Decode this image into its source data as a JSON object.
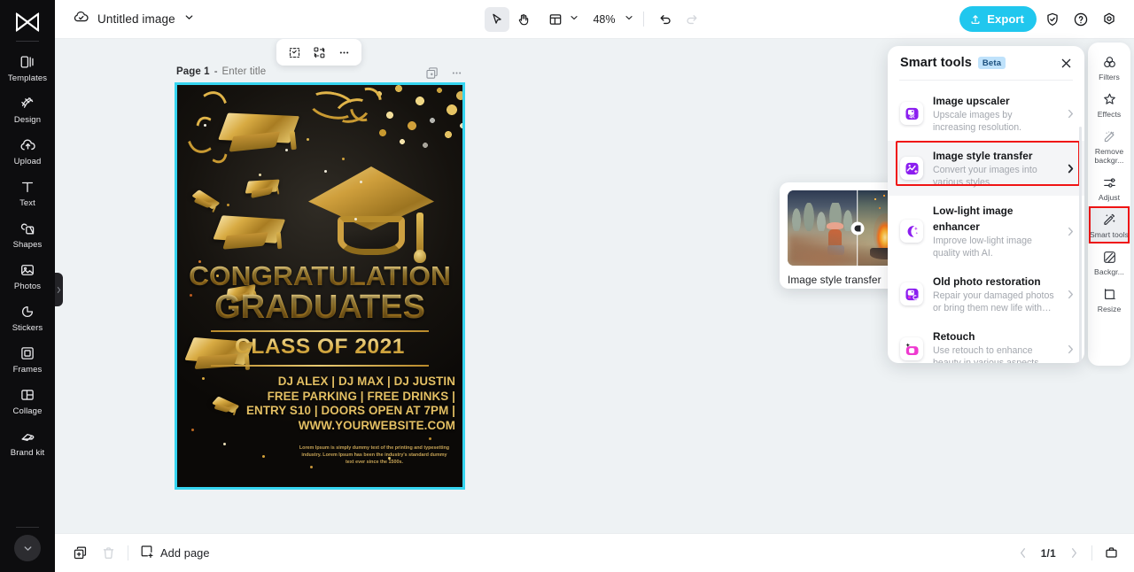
{
  "left_rail": {
    "logo_name": "capcut-logo",
    "items": [
      {
        "label": "Templates",
        "icon": "templates-icon"
      },
      {
        "label": "Design",
        "icon": "design-icon"
      },
      {
        "label": "Upload",
        "icon": "upload-icon"
      },
      {
        "label": "Text",
        "icon": "text-icon"
      },
      {
        "label": "Shapes",
        "icon": "shapes-icon"
      },
      {
        "label": "Photos",
        "icon": "photos-icon"
      },
      {
        "label": "Stickers",
        "icon": "stickers-icon"
      },
      {
        "label": "Frames",
        "icon": "frames-icon"
      },
      {
        "label": "Collage",
        "icon": "collage-icon"
      },
      {
        "label": "Brand kit",
        "icon": "brand-kit-icon"
      }
    ]
  },
  "topbar": {
    "cloud_icon": "cloud-check-icon",
    "doc_title": "Untitled image",
    "title_caret": "chevron-down-icon",
    "select_tool": "cursor-arrow-icon",
    "hand_tool": "hand-icon",
    "layout_tool": "layout-icon",
    "zoom_value": "48%",
    "undo": "undo-icon",
    "redo": "redo-icon",
    "export_label": "Export",
    "shield": "shield-icon",
    "help": "help-circle-icon",
    "settings": "settings-icon"
  },
  "canvas": {
    "page_label": "Page 1",
    "page_dash": "-",
    "page_title_placeholder": "Enter title",
    "float_tools": [
      "crop-icon",
      "replace-icon",
      "more-horizontal-icon"
    ],
    "page_actions": [
      "duplicate-page-icon",
      "more-horizontal-icon"
    ],
    "selection_color": "#36d5f0"
  },
  "poster": {
    "headline_1": "CONGRATULATION",
    "headline_2": "GRADUATES",
    "subtitle": "CLASS OF 2021",
    "detail_lines": [
      "DJ ALEX | DJ MAX | DJ JUSTIN",
      "FREE  PARKING | FREE DRINKS |",
      "ENTRY S10 | DOORS OPEN AT 7PM |",
      "WWW.YOURWEBSITE.COM"
    ],
    "lorem": "Lorem Ipsum is simply dummy text of the printing and typesetting industry. Lorem Ipsum has been the industry's standard dummy text ever since the 1500s.",
    "gold_color": "#d9ae45"
  },
  "preview_card": {
    "caption": "Image style transfer",
    "handle_icon": "compare-slider-handle-icon"
  },
  "smart_panel": {
    "title": "Smart tools",
    "badge": "Beta",
    "close_icon": "close-icon",
    "items": [
      {
        "name": "Image upscaler",
        "desc": "Upscale images by increasing resolution.",
        "icon": "image-upscaler-icon",
        "arrow": "chevron-right-icon"
      },
      {
        "name": "Image style transfer",
        "desc": "Convert your images into various styles.",
        "icon": "image-style-transfer-icon",
        "arrow": "chevron-right-icon"
      },
      {
        "name": "Low-light image enhancer",
        "desc": "Improve low-light image quality with AI.",
        "icon": "low-light-enhancer-icon",
        "arrow": "chevron-right-icon"
      },
      {
        "name": "Old photo restoration",
        "desc": "Repair your damaged photos or bring them new life with…",
        "icon": "old-photo-restoration-icon",
        "arrow": "chevron-right-icon"
      },
      {
        "name": "Retouch",
        "desc": "Use retouch to enhance beauty in various aspects.",
        "icon": "retouch-icon",
        "arrow": "chevron-right-icon"
      }
    ],
    "highlight_color": "#f01414"
  },
  "right_rail": {
    "items": [
      {
        "label": "Filters",
        "icon": "filters-icon"
      },
      {
        "label": "Effects",
        "icon": "effects-icon"
      },
      {
        "label": "Remove backgr...",
        "icon": "remove-background-icon"
      },
      {
        "label": "Adjust",
        "icon": "adjust-icon"
      },
      {
        "label": "Smart tools",
        "icon": "smart-tools-icon"
      },
      {
        "label": "Backgr...",
        "icon": "background-icon"
      },
      {
        "label": "Resize",
        "icon": "resize-icon"
      }
    ],
    "active_index": 4
  },
  "bottombar": {
    "duplicate_icon": "duplicate-icon",
    "delete_icon": "trash-icon",
    "add_page_icon": "add-page-icon",
    "add_page_label": "Add page",
    "prev_icon": "chevron-left-icon",
    "page_count": "1/1",
    "next_icon": "chevron-right-icon",
    "present_icon": "present-icon"
  }
}
